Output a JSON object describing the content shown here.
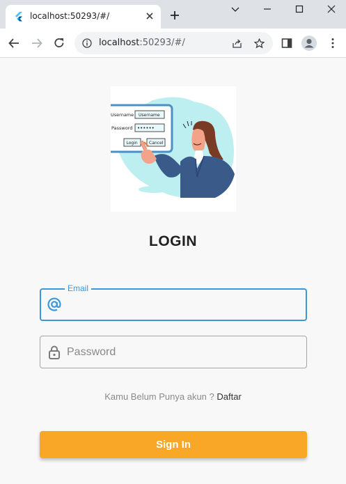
{
  "browser": {
    "tab": {
      "title": "localhost:50293/#/",
      "favicon": "flutter-icon"
    },
    "address": {
      "host": "localhost",
      "path": ":50293/#/"
    },
    "icons": [
      "back-icon",
      "forward-icon",
      "reload-icon",
      "info-icon",
      "share-icon",
      "star-icon",
      "side-panel-icon",
      "profile-icon",
      "menu-icon"
    ]
  },
  "hero": {
    "illustration_labels": {
      "username_label": "Username",
      "username_value": "Username",
      "password_label": "Password",
      "password_value": "••••••",
      "login_btn": "Login",
      "cancel_btn": "Cancel"
    }
  },
  "login": {
    "title": "LOGIN",
    "email": {
      "label": "Email",
      "value": "",
      "icon": "at-icon"
    },
    "password": {
      "placeholder": "Password",
      "value": "",
      "icon": "lock-icon"
    },
    "signup_prompt": "Kamu Belum Punya akun  ? ",
    "signup_link": "Daftar",
    "signin_label": "Sign In"
  },
  "colors": {
    "accent": "#3b97d9",
    "button": "#f9a727",
    "background": "#f8f8f8"
  }
}
